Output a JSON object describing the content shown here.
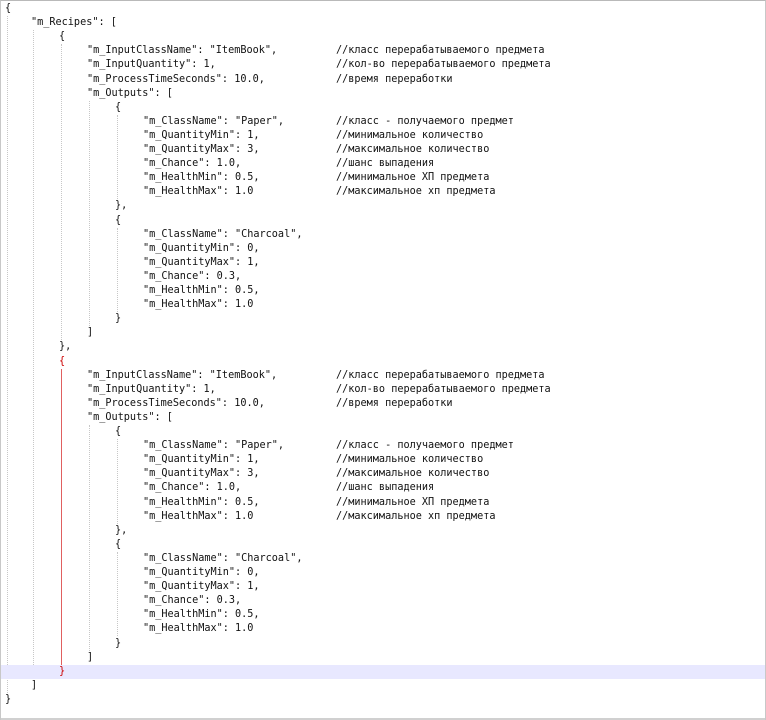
{
  "editor": {
    "lines": [
      {
        "indent": 0,
        "code": "{",
        "comment": ""
      },
      {
        "indent": 1,
        "code": "\"m_Recipes\": [",
        "comment": ""
      },
      {
        "indent": 2,
        "code": "{",
        "comment": ""
      },
      {
        "indent": 3,
        "code": "\"m_InputClassName\": \"ItemBook\",",
        "comment": "//класс перерабатываемого предмета"
      },
      {
        "indent": 3,
        "code": "\"m_InputQuantity\": 1,",
        "comment": "//кол-во перерабатываемого предмета"
      },
      {
        "indent": 3,
        "code": "\"m_ProcessTimeSeconds\": 10.0,",
        "comment": "//время переработки"
      },
      {
        "indent": 3,
        "code": "\"m_Outputs\": [",
        "comment": ""
      },
      {
        "indent": 4,
        "code": "{",
        "comment": ""
      },
      {
        "indent": 5,
        "code": "\"m_ClassName\": \"Paper\",",
        "comment": "//класс - получаемого предмет"
      },
      {
        "indent": 5,
        "code": "\"m_QuantityMin\": 1,",
        "comment": "//минимальное количество"
      },
      {
        "indent": 5,
        "code": "\"m_QuantityMax\": 3,",
        "comment": "//максимальное количество"
      },
      {
        "indent": 5,
        "code": "\"m_Chance\": 1.0,",
        "comment": "//шанс выпадения"
      },
      {
        "indent": 5,
        "code": "\"m_HealthMin\": 0.5,",
        "comment": "//минимальное ХП предмета"
      },
      {
        "indent": 5,
        "code": "\"m_HealthMax\": 1.0",
        "comment": "//максимальное хп предмета"
      },
      {
        "indent": 4,
        "code": "},",
        "comment": ""
      },
      {
        "indent": 4,
        "code": "{",
        "comment": ""
      },
      {
        "indent": 5,
        "code": "\"m_ClassName\": \"Charcoal\",",
        "comment": ""
      },
      {
        "indent": 5,
        "code": "\"m_QuantityMin\": 0,",
        "comment": ""
      },
      {
        "indent": 5,
        "code": "\"m_QuantityMax\": 1,",
        "comment": ""
      },
      {
        "indent": 5,
        "code": "\"m_Chance\": 0.3,",
        "comment": ""
      },
      {
        "indent": 5,
        "code": "\"m_HealthMin\": 0.5,",
        "comment": ""
      },
      {
        "indent": 5,
        "code": "\"m_HealthMax\": 1.0",
        "comment": ""
      },
      {
        "indent": 4,
        "code": "}",
        "comment": ""
      },
      {
        "indent": 3,
        "code": "]",
        "comment": ""
      },
      {
        "indent": 2,
        "code": "},",
        "comment": ""
      },
      {
        "indent": 2,
        "code": "{",
        "comment": "",
        "red": true
      },
      {
        "indent": 3,
        "code": "\"m_InputClassName\": \"ItemBook\",",
        "comment": "//класс перерабатываемого предмета"
      },
      {
        "indent": 3,
        "code": "\"m_InputQuantity\": 1,",
        "comment": "//кол-во перерабатываемого предмета"
      },
      {
        "indent": 3,
        "code": "\"m_ProcessTimeSeconds\": 10.0,",
        "comment": "//время переработки"
      },
      {
        "indent": 3,
        "code": "\"m_Outputs\": [",
        "comment": ""
      },
      {
        "indent": 4,
        "code": "{",
        "comment": ""
      },
      {
        "indent": 5,
        "code": "\"m_ClassName\": \"Paper\",",
        "comment": "//класс - получаемого предмет"
      },
      {
        "indent": 5,
        "code": "\"m_QuantityMin\": 1,",
        "comment": "//минимальное количество"
      },
      {
        "indent": 5,
        "code": "\"m_QuantityMax\": 3,",
        "comment": "//максимальное количество"
      },
      {
        "indent": 5,
        "code": "\"m_Chance\": 1.0,",
        "comment": "//шанс выпадения"
      },
      {
        "indent": 5,
        "code": "\"m_HealthMin\": 0.5,",
        "comment": "//минимальное ХП предмета"
      },
      {
        "indent": 5,
        "code": "\"m_HealthMax\": 1.0",
        "comment": "//максимальное хп предмета"
      },
      {
        "indent": 4,
        "code": "},",
        "comment": ""
      },
      {
        "indent": 4,
        "code": "{",
        "comment": ""
      },
      {
        "indent": 5,
        "code": "\"m_ClassName\": \"Charcoal\",",
        "comment": ""
      },
      {
        "indent": 5,
        "code": "\"m_QuantityMin\": 0,",
        "comment": ""
      },
      {
        "indent": 5,
        "code": "\"m_QuantityMax\": 1,",
        "comment": ""
      },
      {
        "indent": 5,
        "code": "\"m_Chance\": 0.3,",
        "comment": ""
      },
      {
        "indent": 5,
        "code": "\"m_HealthMin\": 0.5,",
        "comment": ""
      },
      {
        "indent": 5,
        "code": "\"m_HealthMax\": 1.0",
        "comment": ""
      },
      {
        "indent": 4,
        "code": "}",
        "comment": ""
      },
      {
        "indent": 3,
        "code": "]",
        "comment": ""
      },
      {
        "indent": 2,
        "code": "}",
        "comment": "",
        "red": true,
        "current": true
      },
      {
        "indent": 1,
        "code": "]",
        "comment": ""
      },
      {
        "indent": 0,
        "code": "}",
        "comment": ""
      }
    ],
    "colors": {
      "text": "#111111",
      "bracket_match": "#cc0000",
      "current_line": "#e8e8ff",
      "indent_guide": "#c7c7c7"
    }
  }
}
